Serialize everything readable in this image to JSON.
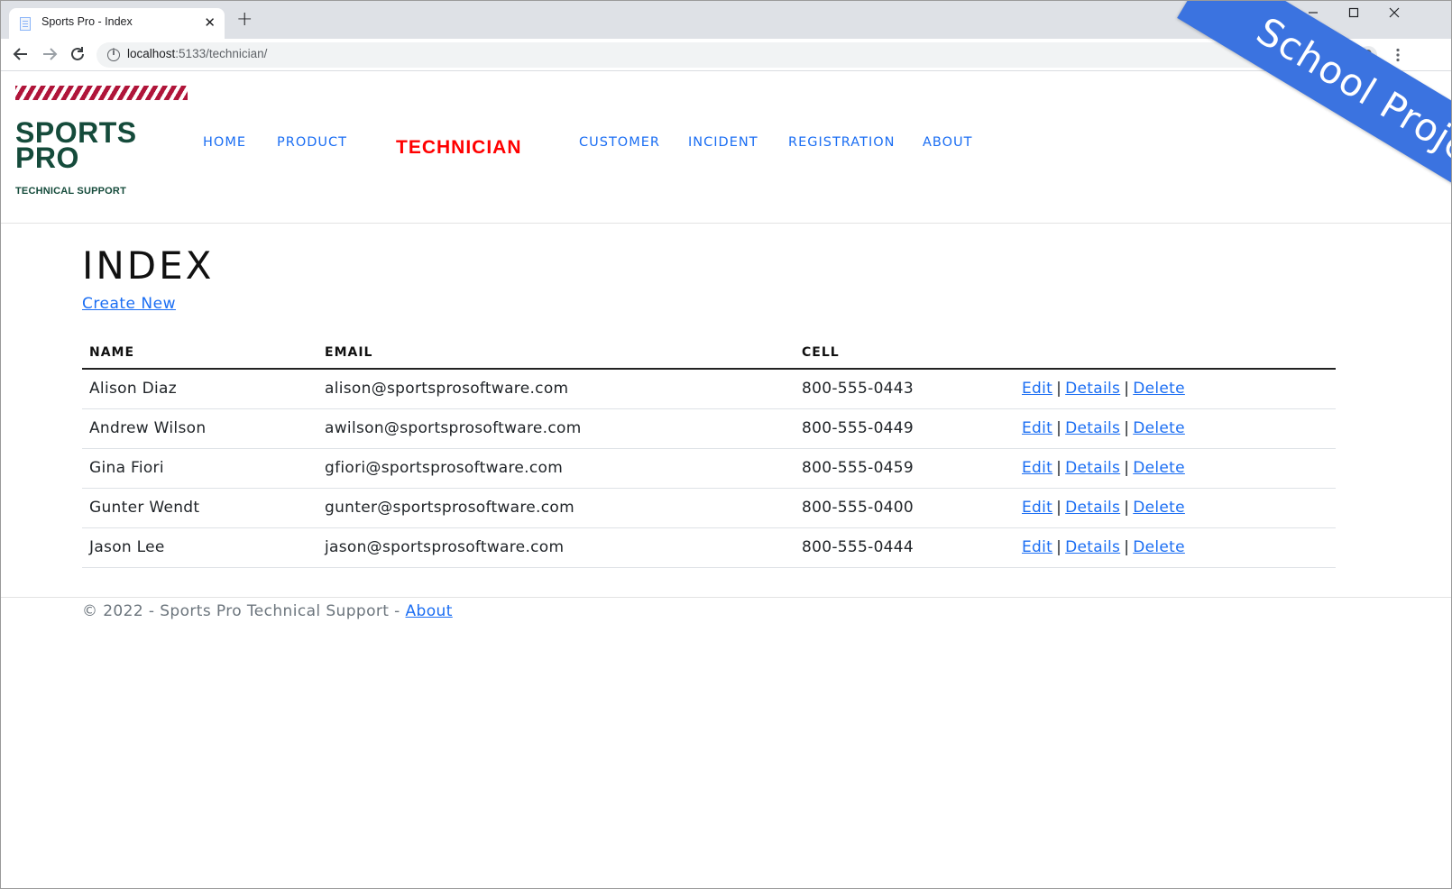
{
  "browser": {
    "tab_title": "Sports Pro - Index",
    "tab_close": "✕",
    "new_tab": "+",
    "url_host": "localhost",
    "url_path": ":5133/technician/",
    "window_controls": {
      "chevron": "⌄",
      "minimize": "—",
      "maximize": "☐",
      "close": "✕"
    }
  },
  "site": {
    "logo_line1": "SPORTS",
    "logo_line2": "PRO",
    "logo_tagline": "TECHNICAL SUPPORT",
    "nav": [
      {
        "label": "HOME"
      },
      {
        "label": "PRODUCT"
      },
      {
        "label": "TECHNICIAN",
        "active": true
      },
      {
        "label": "CUSTOMER"
      },
      {
        "label": "INCIDENT"
      },
      {
        "label": "REGISTRATION"
      },
      {
        "label": "ABOUT"
      }
    ],
    "ribbon_text": "School Project"
  },
  "main": {
    "title": "INDEX",
    "create_link": "Create New",
    "table": {
      "headers": [
        "NAME",
        "EMAIL",
        "CELL",
        ""
      ],
      "action_labels": {
        "edit": "Edit",
        "details": "Details",
        "delete": "Delete",
        "separator": "|"
      },
      "rows": [
        {
          "name": "Alison Diaz",
          "email": "alison@sportsprosoftware.com",
          "cell": "800-555-0443"
        },
        {
          "name": "Andrew Wilson",
          "email": "awilson@sportsprosoftware.com",
          "cell": "800-555-0449"
        },
        {
          "name": "Gina Fiori",
          "email": "gfiori@sportsprosoftware.com",
          "cell": "800-555-0459"
        },
        {
          "name": "Gunter Wendt",
          "email": "gunter@sportsprosoftware.com",
          "cell": "800-555-0400"
        },
        {
          "name": "Jason Lee",
          "email": "jason@sportsprosoftware.com",
          "cell": "800-555-0444"
        }
      ]
    }
  },
  "footer": {
    "text": "© 2022 - Sports Pro Technical Support - ",
    "link": "About"
  },
  "colors": {
    "link": "#1b6ef3",
    "active_nav": "#ff0000",
    "logo_green": "#154b3b",
    "stripe_red": "#b0153a",
    "ribbon_blue": "#3b73e0"
  }
}
